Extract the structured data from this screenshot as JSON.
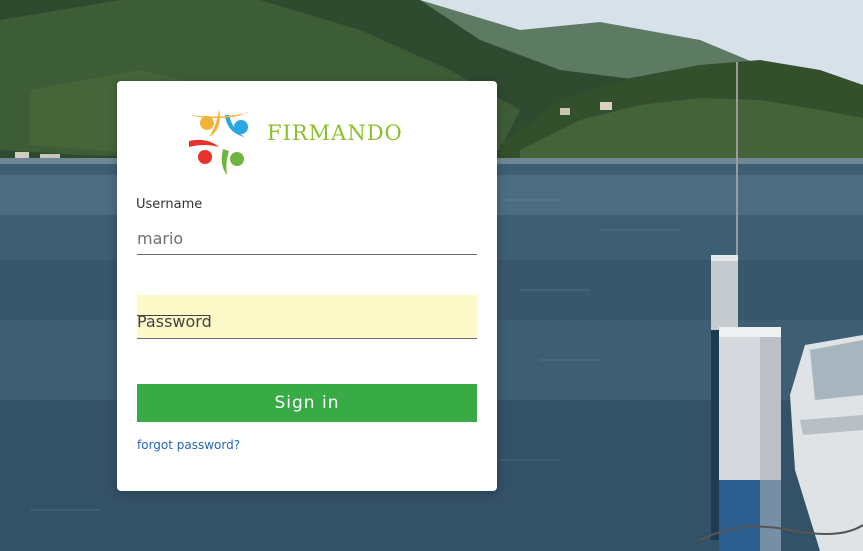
{
  "brand": {
    "name": "FIRMANDO",
    "text_color": "#8dbf2d",
    "swoosh_color": "#f3b23a"
  },
  "login": {
    "username_label": "Username",
    "username_value": "mario",
    "password_placeholder": "Password",
    "password_field_bg": "#fdf9c9",
    "signin_label": "Sign in",
    "signin_color": "#39ab46",
    "forgot_label": "forgot password?"
  },
  "background": {
    "description_icon": "lake-landscape-photo"
  }
}
